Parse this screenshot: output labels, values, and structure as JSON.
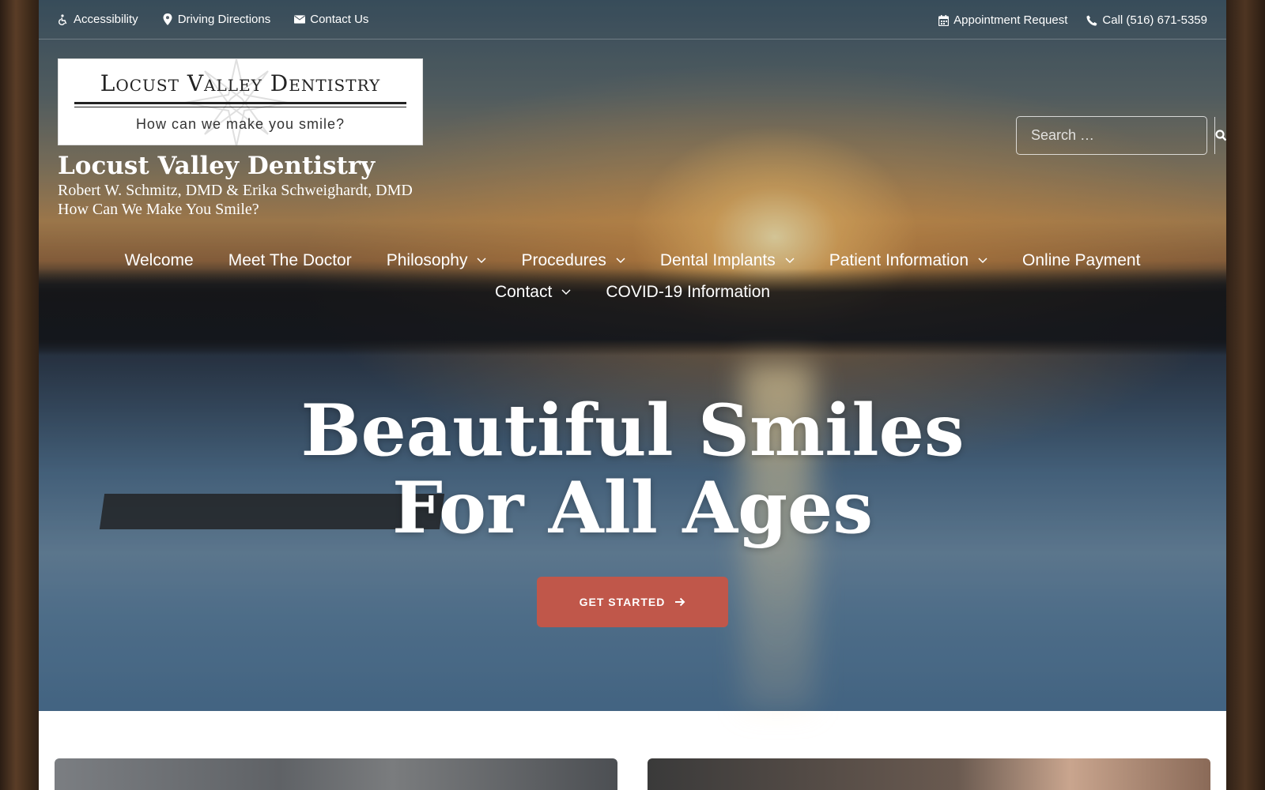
{
  "topbar": {
    "left": [
      {
        "icon": "wheelchair-icon",
        "label": "Accessibility"
      },
      {
        "icon": "map-marker-icon",
        "label": "Driving Directions"
      },
      {
        "icon": "envelope-icon",
        "label": "Contact Us"
      }
    ],
    "right": [
      {
        "icon": "calendar-icon",
        "label": "Appointment Request"
      },
      {
        "icon": "phone-icon",
        "label": "Call (516) 671-5359"
      }
    ]
  },
  "logo": {
    "title": "Locust Valley Dentistry",
    "tagline": "How can we make you smile?"
  },
  "site": {
    "title": "Locust Valley Dentistry",
    "doctors": "Robert W. Schmitz, DMD & Erika Schweighardt, DMD",
    "slogan": "How Can We Make You Smile?"
  },
  "search": {
    "placeholder": "Search …",
    "icon": "search-icon"
  },
  "nav": {
    "row1": [
      {
        "label": "Welcome",
        "dropdown": false
      },
      {
        "label": "Meet The Doctor",
        "dropdown": false
      },
      {
        "label": "Philosophy",
        "dropdown": true
      },
      {
        "label": "Procedures",
        "dropdown": true
      },
      {
        "label": "Dental Implants",
        "dropdown": true
      },
      {
        "label": "Patient Information",
        "dropdown": true
      },
      {
        "label": "Online Payment",
        "dropdown": false
      }
    ],
    "row2": [
      {
        "label": "Contact",
        "dropdown": true
      },
      {
        "label": "COVID-19 Information",
        "dropdown": false
      }
    ]
  },
  "hero": {
    "headline_line1": "Beautiful Smiles",
    "headline_line2": "For All Ages",
    "cta_label": "GET STARTED",
    "cta_icon": "arrow-right-icon"
  },
  "colors": {
    "cta": "#c0574a",
    "text_on_hero": "#ffffff"
  }
}
